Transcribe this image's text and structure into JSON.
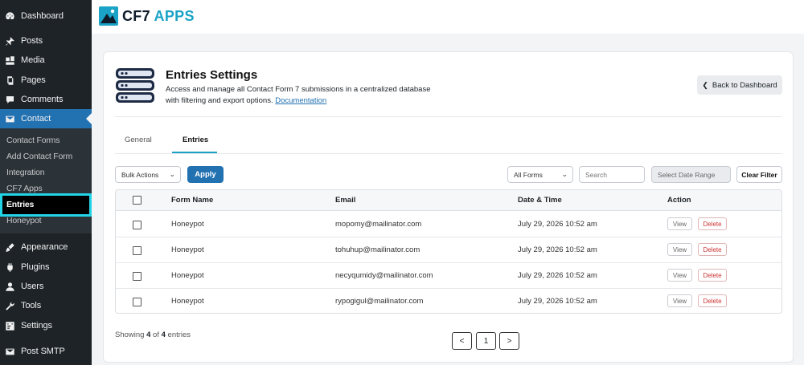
{
  "sidebar": {
    "menu": [
      {
        "label": "Dashboard",
        "icon": "dashboard-icon"
      },
      {
        "label": "Posts",
        "icon": "pin-icon"
      },
      {
        "label": "Media",
        "icon": "media-icon"
      },
      {
        "label": "Pages",
        "icon": "pages-icon"
      },
      {
        "label": "Comments",
        "icon": "comment-icon"
      },
      {
        "label": "Contact",
        "icon": "mail-icon"
      },
      {
        "label": "Appearance",
        "icon": "brush-icon"
      },
      {
        "label": "Plugins",
        "icon": "plugin-icon"
      },
      {
        "label": "Users",
        "icon": "user-icon"
      },
      {
        "label": "Tools",
        "icon": "wrench-icon"
      },
      {
        "label": "Settings",
        "icon": "settings-icon"
      },
      {
        "label": "Post SMTP",
        "icon": "mail-icon"
      }
    ],
    "submenu": [
      "Contact Forms",
      "Add Contact Form",
      "Integration",
      "CF7 Apps",
      "Entries",
      "Honeypot"
    ]
  },
  "brand": {
    "name_part1": "CF7",
    "name_part2": "APPS"
  },
  "header": {
    "title": "Entries Settings",
    "description": "Access and manage all Contact Form 7 submissions in a centralized database with filtering and export options.",
    "doc_link": "Documentation",
    "back_button": "Back to Dashboard"
  },
  "tabs": [
    {
      "label": "General"
    },
    {
      "label": "Entries"
    }
  ],
  "filters": {
    "bulk_actions": "Bulk Actions",
    "apply": "Apply",
    "forms_select": "All Forms",
    "search_placeholder": "Search",
    "date_range_placeholder": "Select Date Range",
    "clear_filter": "Clear Filter"
  },
  "table": {
    "columns": [
      "Form Name",
      "Email",
      "Date & Time",
      "Action"
    ],
    "rows": [
      {
        "form": "Honeypot",
        "email": "mopomy@mailinator.com",
        "datetime": "July 29, 2026 10:52 am"
      },
      {
        "form": "Honeypot",
        "email": "tohuhup@mailinator.com",
        "datetime": "July 29, 2026 10:52 am"
      },
      {
        "form": "Honeypot",
        "email": "necyqumidy@mailinator.com",
        "datetime": "July 29, 2026 10:52 am"
      },
      {
        "form": "Honeypot",
        "email": "rypogigul@mailinator.com",
        "datetime": "July 29, 2026 10:52 am"
      }
    ],
    "view_label": "View",
    "delete_label": "Delete"
  },
  "footer": {
    "showing_prefix": "Showing",
    "showing_count": "4",
    "showing_of": "of",
    "showing_total": "4",
    "showing_suffix": "entries",
    "prev": "<",
    "page": "1",
    "next": ">"
  },
  "colors": {
    "accent": "#2271b1",
    "brand_teal": "#1aa3c6",
    "sidebar_bg": "#1d2327",
    "highlight": "#22d3e6"
  }
}
